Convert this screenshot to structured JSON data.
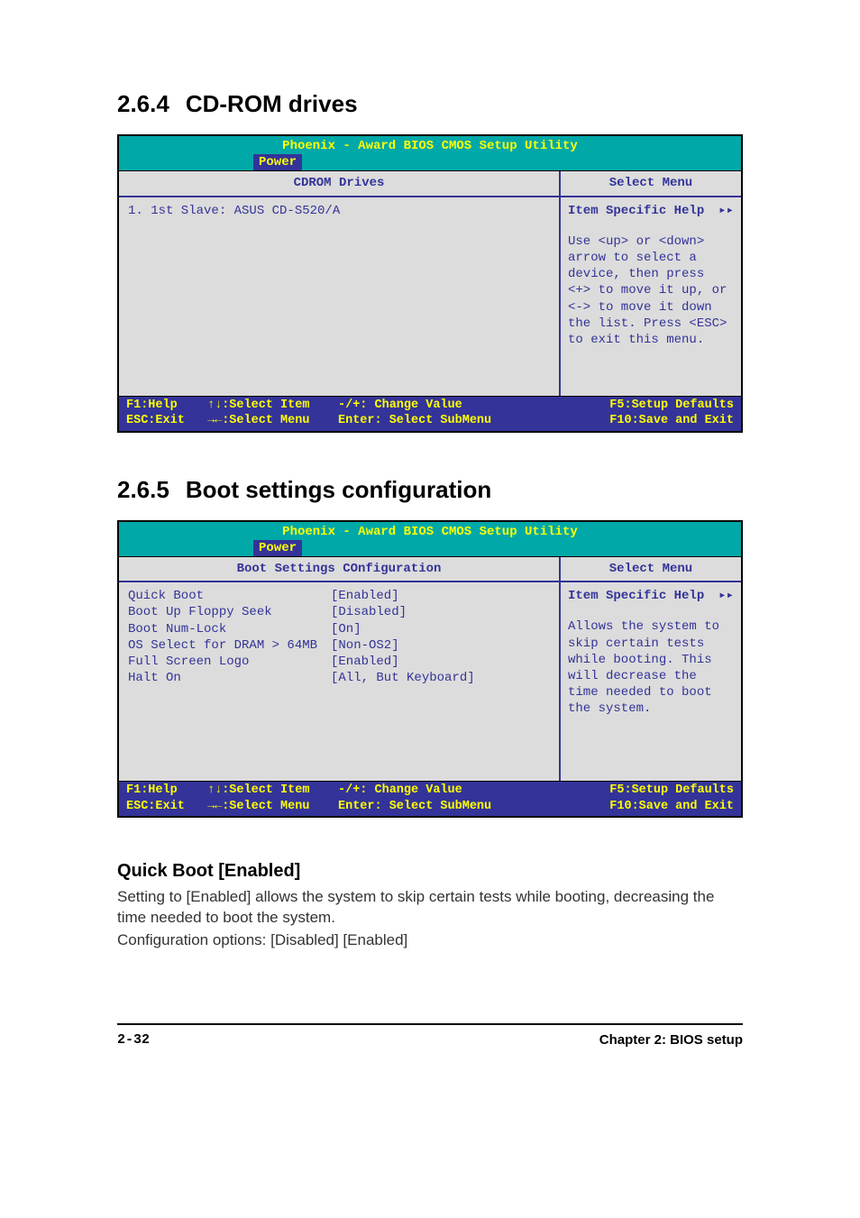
{
  "section1": {
    "number": "2.6.4",
    "title": "CD-ROM drives"
  },
  "section2": {
    "number": "2.6.5",
    "title": "Boot settings configuration"
  },
  "bios1": {
    "appTitle": "Phoenix - Award BIOS CMOS Setup Utility",
    "tab": "Power",
    "leftHeader": "CDROM Drives",
    "rightHeader": "Select Menu",
    "item": "1. 1st Slave: ASUS CD-S520/A",
    "helpTitle": "Item Specific Help",
    "helpArrow": "▸▸",
    "helpBody": "Use <up> or <down> arrow to select a device, then press <+> to move it up, or <-> to move it down the list. Press <ESC> to exit this menu.",
    "footer": {
      "f1": "F1:Help",
      "esc": "ESC:Exit",
      "selItem": "↑↓:Select Item",
      "selMenu": "→←:Select Menu",
      "change": "-/+: Change Value",
      "enter": "Enter: Select SubMenu",
      "f5": "F5:Setup Defaults",
      "f10": "F10:Save and Exit"
    }
  },
  "bios2": {
    "appTitle": "Phoenix - Award BIOS CMOS Setup Utility",
    "tab": "Power",
    "leftHeader": "Boot Settings COnfiguration",
    "rightHeader": "Select Menu",
    "rows": [
      {
        "label": "Quick Boot",
        "value": "[Enabled]"
      },
      {
        "label": "Boot Up Floppy Seek",
        "value": "[Disabled]"
      },
      {
        "label": "Boot Num-Lock",
        "value": "[On]"
      },
      {
        "label": "OS Select for DRAM > 64MB",
        "value": "[Non-OS2]"
      },
      {
        "label": "Full Screen Logo",
        "value": "[Enabled]"
      },
      {
        "label": "Halt On",
        "value": "[All, But Keyboard]"
      }
    ],
    "helpTitle": "Item Specific Help",
    "helpArrow": "▸▸",
    "helpBody": "Allows the system to skip certain tests while booting. This will decrease the time needed to boot the system.",
    "footer": {
      "f1": "F1:Help",
      "esc": "ESC:Exit",
      "selItem": "↑↓:Select Item",
      "selMenu": "→←:Select Menu",
      "change": "-/+: Change Value",
      "enter": "Enter: Select SubMenu",
      "f5": "F5:Setup Defaults",
      "f10": "F10:Save and Exit"
    }
  },
  "quickBoot": {
    "heading": "Quick Boot [Enabled]",
    "line1": "Setting to [Enabled] allows the system to skip certain tests while booting, decreasing the time needed to boot the system.",
    "line2": "Configuration options: [Disabled] [Enabled]"
  },
  "pageFooter": {
    "left": "2-32",
    "right": "Chapter 2: BIOS setup"
  }
}
